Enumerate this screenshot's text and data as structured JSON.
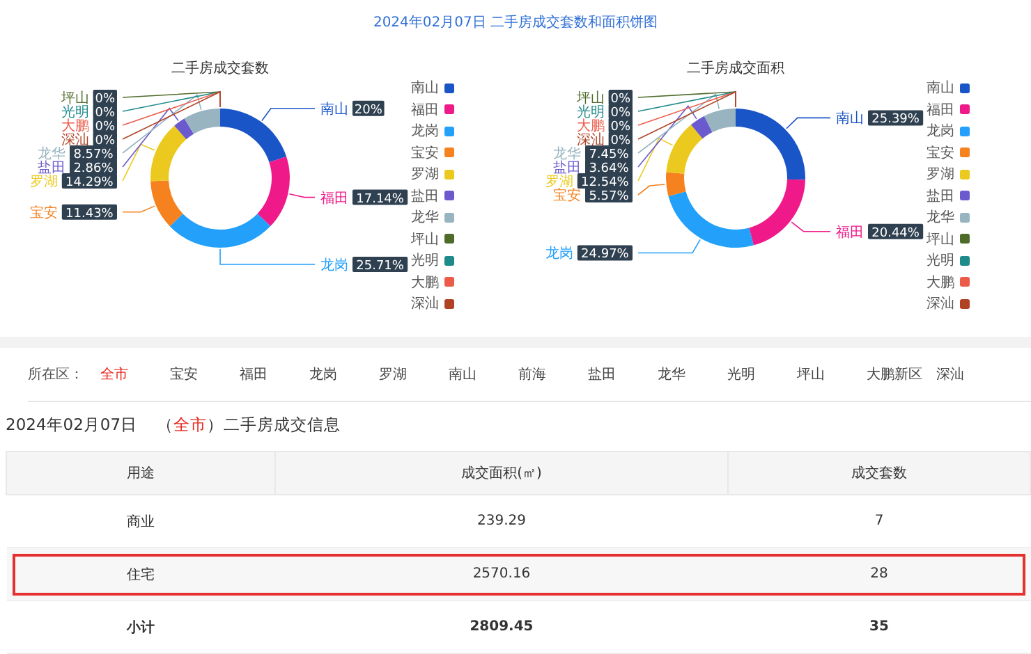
{
  "page_title": "2024年02月07日 二手房成交套数和面积饼图",
  "charts": [
    {
      "title": "二手房成交套数",
      "legend": [
        {
          "label": "南山",
          "color": "#1a55c8"
        },
        {
          "label": "福田",
          "color": "#f0198a"
        },
        {
          "label": "龙岗",
          "color": "#22a0fa"
        },
        {
          "label": "宝安",
          "color": "#f5821f"
        },
        {
          "label": "罗湖",
          "color": "#ecc91e"
        },
        {
          "label": "盐田",
          "color": "#6a5acd"
        },
        {
          "label": "龙华",
          "color": "#97b4c0"
        },
        {
          "label": "坪山",
          "color": "#4f6b2a"
        },
        {
          "label": "光明",
          "color": "#1f8a8a"
        },
        {
          "label": "大鹏",
          "color": "#ec5b4a"
        },
        {
          "label": "深汕",
          "color": "#b04325"
        }
      ],
      "chart_data": {
        "type": "donut",
        "categories": [
          "南山",
          "福田",
          "龙岗",
          "宝安",
          "罗湖",
          "盐田",
          "龙华",
          "坪山",
          "光明",
          "大鹏",
          "深汕"
        ],
        "values": [
          20,
          17.14,
          25.71,
          11.43,
          14.29,
          2.86,
          8.57,
          0,
          0,
          0,
          0
        ],
        "value_labels": [
          "20%",
          "17.14%",
          "25.71%",
          "11.43%",
          "14.29%",
          "2.86%",
          "8.57%",
          "0%",
          "0%",
          "0%",
          "0%"
        ]
      }
    },
    {
      "title": "二手房成交面积",
      "legend": [
        {
          "label": "南山",
          "color": "#1a55c8"
        },
        {
          "label": "福田",
          "color": "#f0198a"
        },
        {
          "label": "龙岗",
          "color": "#22a0fa"
        },
        {
          "label": "宝安",
          "color": "#f5821f"
        },
        {
          "label": "罗湖",
          "color": "#ecc91e"
        },
        {
          "label": "盐田",
          "color": "#6a5acd"
        },
        {
          "label": "龙华",
          "color": "#97b4c0"
        },
        {
          "label": "坪山",
          "color": "#4f6b2a"
        },
        {
          "label": "光明",
          "color": "#1f8a8a"
        },
        {
          "label": "大鹏",
          "color": "#ec5b4a"
        },
        {
          "label": "深汕",
          "color": "#b04325"
        }
      ],
      "chart_data": {
        "type": "donut",
        "categories": [
          "南山",
          "福田",
          "龙岗",
          "宝安",
          "罗湖",
          "盐田",
          "龙华",
          "坪山",
          "光明",
          "大鹏",
          "深汕"
        ],
        "values": [
          25.39,
          20.44,
          24.97,
          5.57,
          12.54,
          3.64,
          7.45,
          0,
          0,
          0,
          0
        ],
        "value_labels": [
          "25.39%",
          "20.44%",
          "24.97%",
          "5.57%",
          "12.54%",
          "3.64%",
          "7.45%",
          "0%",
          "0%",
          "0%",
          "0%"
        ]
      }
    }
  ],
  "district_filter": {
    "label": "所在区：",
    "items": [
      {
        "label": "全市",
        "selected": true
      },
      {
        "label": "宝安",
        "selected": false
      },
      {
        "label": "福田",
        "selected": false
      },
      {
        "label": "龙岗",
        "selected": false
      },
      {
        "label": "罗湖",
        "selected": false
      },
      {
        "label": "南山",
        "selected": false
      },
      {
        "label": "前海",
        "selected": false
      },
      {
        "label": "盐田",
        "selected": false
      },
      {
        "label": "龙华",
        "selected": false
      },
      {
        "label": "光明",
        "selected": false
      },
      {
        "label": "坪山",
        "selected": false
      },
      {
        "label": "大鹏新区",
        "selected": false
      },
      {
        "label": "深汕",
        "selected": false
      }
    ]
  },
  "info_heading": {
    "date": "2024年02月07日",
    "open": "（",
    "region": "全市",
    "rest": "）二手房成交信息"
  },
  "table": {
    "columns": [
      "用途",
      "成交面积(㎡)",
      "成交套数"
    ],
    "rows": [
      {
        "kind": "data",
        "highlighted": false,
        "cells": [
          "商业",
          "239.29",
          "7"
        ]
      },
      {
        "kind": "data",
        "highlighted": true,
        "cells": [
          "住宅",
          "2570.16",
          "28"
        ]
      },
      {
        "kind": "total",
        "highlighted": false,
        "cells": [
          "小计",
          "2809.45",
          "35"
        ]
      }
    ]
  }
}
